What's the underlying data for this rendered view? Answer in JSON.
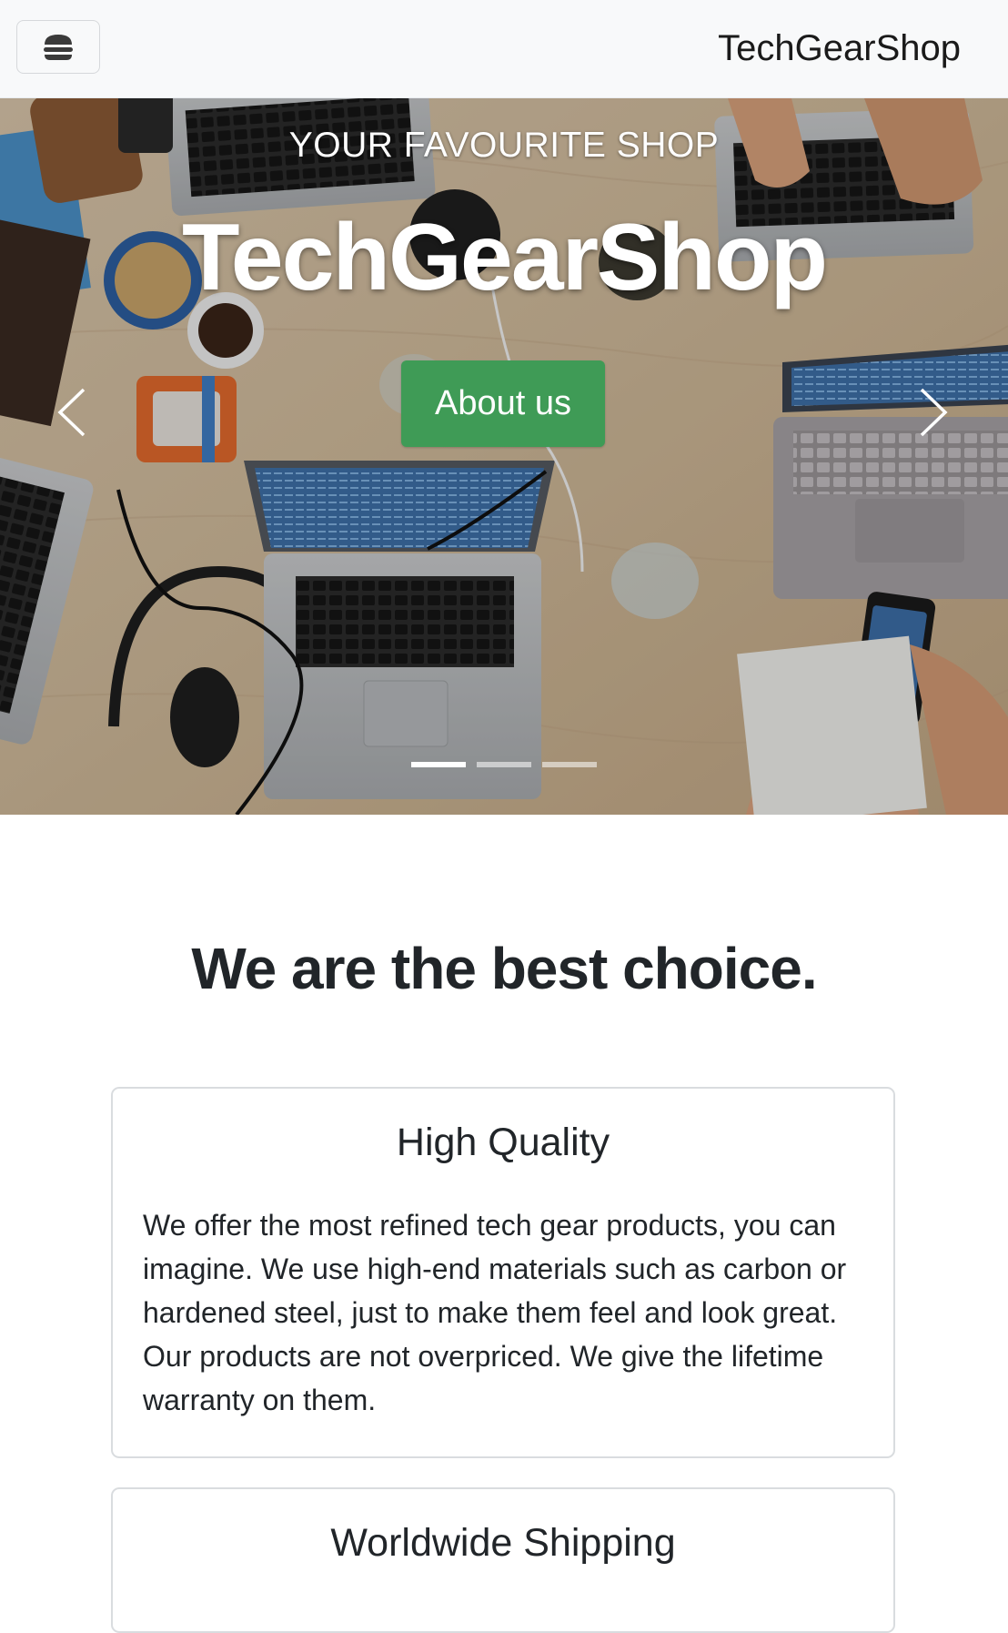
{
  "navbar": {
    "brand": "TechGearShop",
    "menu_icon": "hamburger-icon"
  },
  "hero": {
    "eyebrow": "YOUR FAVOURITE SHOP",
    "title": "TechGearShop",
    "button_label": "About us",
    "prev_icon": "chevron-left-icon",
    "next_icon": "chevron-right-icon",
    "slides_count_shown": 3,
    "active_slide": 1
  },
  "features": {
    "heading": "We are the best choice.",
    "cards": [
      {
        "title": "High Quality",
        "text": "We offer the most refined tech gear products, you can imagine. We use high-end materials such as carbon or hardened steel, just to make them feel and look great. Our products are not overpriced. We give the lifetime warranty on them."
      },
      {
        "title": "Worldwide Shipping"
      }
    ]
  },
  "colors": {
    "navbar_bg": "#f8f9fa",
    "button_green": "#3f9b56",
    "text_dark": "#212529",
    "card_border": "#d9dcdf"
  }
}
